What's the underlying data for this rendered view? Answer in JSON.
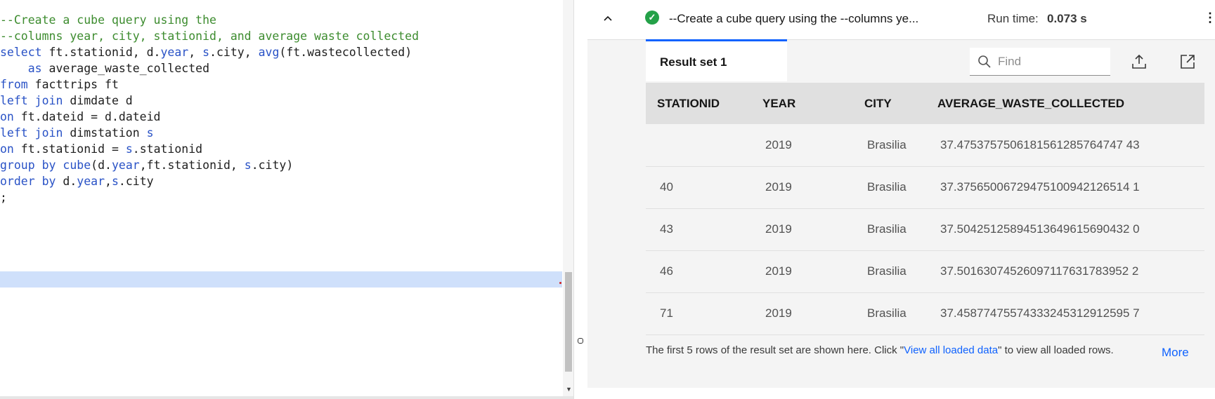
{
  "editor": {
    "lines": [
      [
        {
          "t": "--Create a cube query using the",
          "c": "cm"
        }
      ],
      [
        {
          "t": "--columns year, city, stationid, and average waste collected",
          "c": "cm"
        }
      ],
      [
        {
          "t": "select",
          "c": "kw"
        },
        {
          "t": " ft.stationid, d."
        },
        {
          "t": "year",
          "c": "kw"
        },
        {
          "t": ", "
        },
        {
          "t": "s",
          "c": "kw"
        },
        {
          "t": ".city, "
        },
        {
          "t": "avg",
          "c": "fn"
        },
        {
          "t": "(ft.wastecollected)"
        }
      ],
      [
        {
          "t": "    "
        },
        {
          "t": "as",
          "c": "kw"
        },
        {
          "t": " average_waste_collected"
        }
      ],
      [
        {
          "t": "from",
          "c": "kw"
        },
        {
          "t": " facttrips ft"
        }
      ],
      [
        {
          "t": "left join",
          "c": "kw"
        },
        {
          "t": " dimdate d"
        }
      ],
      [
        {
          "t": "on",
          "c": "kw"
        },
        {
          "t": " ft.dateid = d.dateid"
        }
      ],
      [
        {
          "t": "left join",
          "c": "kw"
        },
        {
          "t": " dimstation "
        },
        {
          "t": "s",
          "c": "kw"
        }
      ],
      [
        {
          "t": "on",
          "c": "kw"
        },
        {
          "t": " ft.stationid = "
        },
        {
          "t": "s",
          "c": "kw"
        },
        {
          "t": ".stationid"
        }
      ],
      [
        {
          "t": "group by",
          "c": "kw"
        },
        {
          "t": " "
        },
        {
          "t": "cube",
          "c": "fn"
        },
        {
          "t": "(d."
        },
        {
          "t": "year",
          "c": "kw"
        },
        {
          "t": ",ft.stationid, "
        },
        {
          "t": "s",
          "c": "kw"
        },
        {
          "t": ".city)"
        }
      ],
      [
        {
          "t": "order by",
          "c": "kw"
        },
        {
          "t": " d."
        },
        {
          "t": "year",
          "c": "kw"
        },
        {
          "t": ","
        },
        {
          "t": "s",
          "c": "kw"
        },
        {
          "t": ".city"
        }
      ],
      [
        {
          "t": ";"
        }
      ]
    ]
  },
  "results": {
    "collapse_icon": "chevron-up-icon",
    "status_icon": "checkmark-filled-icon",
    "status_color": "#24a148",
    "query_title": "--Create a cube query using the --columns ye...",
    "runtime_label": "Run time:",
    "runtime_value": "0.073 s",
    "overflow_icon": "overflow-menu-vertical-icon",
    "tab_label": "Result set 1",
    "find_placeholder": "Find",
    "export_icon": "export-upload-icon",
    "popout_icon": "launch-popout-icon",
    "columns": [
      "STATIONID",
      "YEAR",
      "CITY",
      "AVERAGE_WASTE_COLLECTED"
    ],
    "rows": [
      [
        "",
        "2019",
        "Brasilia",
        "37.4753757506181561285764747 43"
      ],
      [
        "40",
        "2019",
        "Brasilia",
        "37.37565006729475100942126514 1"
      ],
      [
        "43",
        "2019",
        "Brasilia",
        "37.50425125894513649615690432 0"
      ],
      [
        "46",
        "2019",
        "Brasilia",
        "37.50163074526097117631783952 2"
      ],
      [
        "71",
        "2019",
        "Brasilia",
        "37.45877475574333245312912595 7"
      ]
    ],
    "footer_before": "The first 5 rows of the result set are shown here. Click \"",
    "footer_link": "View all loaded data",
    "footer_after": "\" to view all loaded rows.",
    "more_label": "More",
    "accent_color": "#0f62fe"
  }
}
